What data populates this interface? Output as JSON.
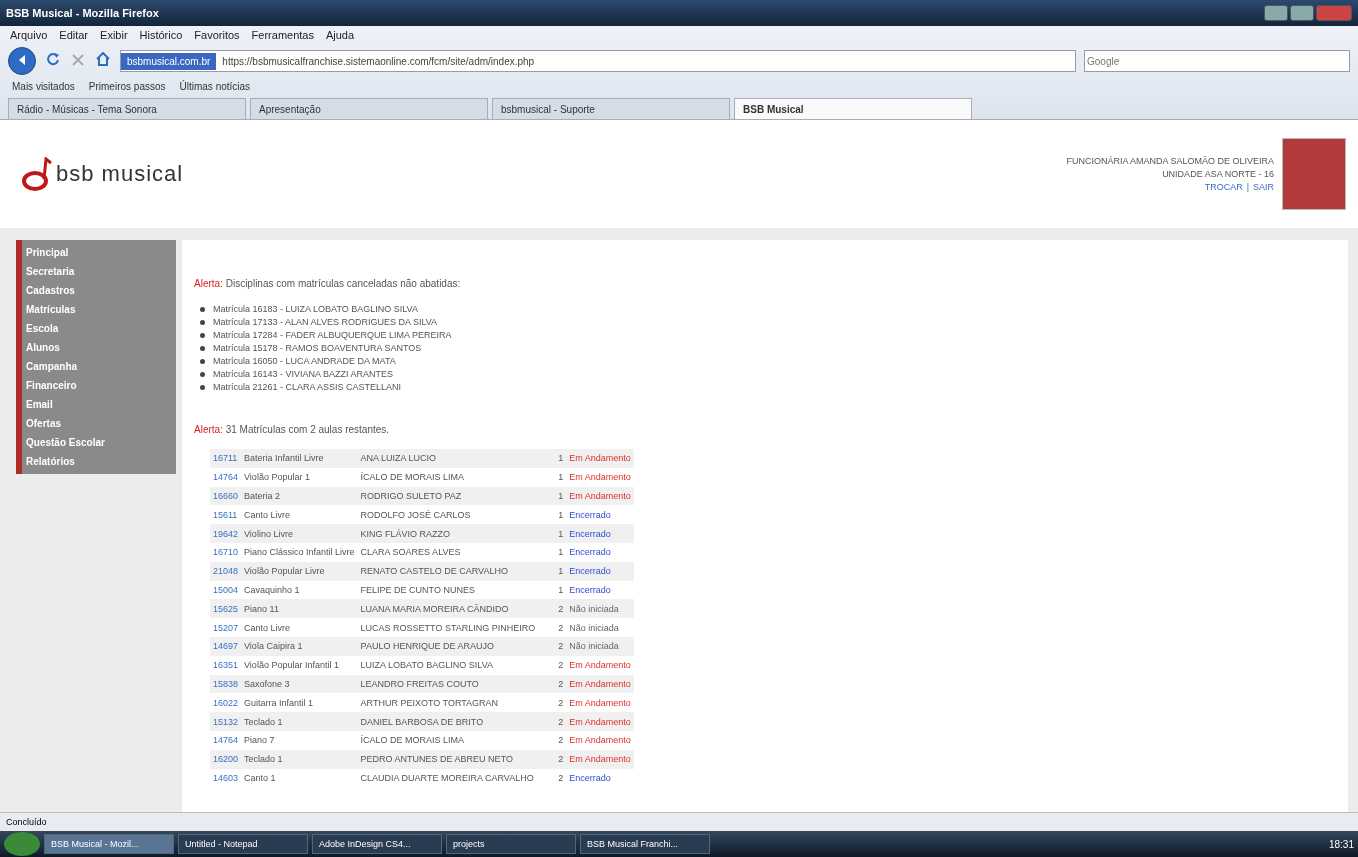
{
  "window": {
    "title": "BSB Musical - Mozilla Firefox"
  },
  "menu": [
    "Arquivo",
    "Editar",
    "Exibir",
    "Histórico",
    "Favoritos",
    "Ferramentas",
    "Ajuda"
  ],
  "address_bar": {
    "site_label": "bsbmusical.com.br",
    "url": "https://bsbmusicalfranchise.sistemaonline.com/fcm/site/adm/index.php"
  },
  "search": {
    "placeholder": "Google"
  },
  "bookmarks": [
    "Mais visitados",
    "Primeiros passos",
    "Últimas notícias"
  ],
  "tabs": [
    {
      "label": "Rádio - Músicas - Tema Sonora",
      "selected": false
    },
    {
      "label": "Apresentação",
      "selected": false
    },
    {
      "label": "bsbmusical - Suporte",
      "selected": false
    },
    {
      "label": "BSB Musical",
      "selected": true
    }
  ],
  "header": {
    "logo": "bsb musical",
    "user_lines": [
      "FUNCIONÁRIA AMANDA SALOMÃO DE OLIVEIRA",
      "UNIDADE ASA NORTE - 16"
    ],
    "links": [
      "TROCAR",
      "SAIR"
    ],
    "link_separator": "|"
  },
  "sidebar": {
    "items": [
      "Principal",
      "Secretaria",
      "Cadastros",
      "Matrículas",
      "Escola",
      "Alunos",
      "Campanha",
      "Financeiro",
      "Email",
      "Ofertas",
      "Questão Escolar",
      "Relatórios"
    ]
  },
  "alerts": [
    {
      "label": "Alerta:",
      "text": "Disciplinas com matrículas canceladas não abatidas:"
    },
    {
      "label": "Alerta:",
      "text": "31 Matrículas com 2 aulas restantes."
    }
  ],
  "canceled": [
    "Matrícula 16183 - LUIZA LOBATO BAGLINO SILVA",
    "Matrícula 17133 - ALAN ALVES RODRIGUES DA SILVA",
    "Matrícula 17284 - FADER ALBUQUERQUE LIMA PEREIRA",
    "Matrícula 15178 - RAMOS BOAVENTURA SANTOS",
    "Matrícula 16050 - LUCA ANDRADE DA MATA",
    "Matrícula 16143 - VIVIANA BAZZI ARANTES",
    "Matrícula 21261 - CLARA ASSIS CASTELLANI"
  ],
  "table": {
    "rows": [
      {
        "id": "16711",
        "course": "Bateria Infantil Livre",
        "student": "ANA LUIZA LUCIO",
        "count": "1",
        "status": "Em Andamento",
        "kind": "progress"
      },
      {
        "id": "14764",
        "course": "Violão Popular 1",
        "student": "ÍCALO DE MORAIS LIMA",
        "count": "1",
        "status": "Em Andamento",
        "kind": "progress"
      },
      {
        "id": "16660",
        "course": "Bateria 2",
        "student": "RODRIGO SULETO PAZ",
        "count": "1",
        "status": "Em Andamento",
        "kind": "progress"
      },
      {
        "id": "15611",
        "course": "Canto Livre",
        "student": "RODOLFO JOSÉ CARLOS",
        "count": "1",
        "status": "Encerrado",
        "kind": "closed"
      },
      {
        "id": "19642",
        "course": "Violino Livre",
        "student": "KING FLÁVIO RAZZO",
        "count": "1",
        "status": "Encerrado",
        "kind": "closed"
      },
      {
        "id": "16710",
        "course": "Piano Clássico Infantil Livre",
        "student": "CLARA SOARES ALVES",
        "count": "1",
        "status": "Encerrado",
        "kind": "closed"
      },
      {
        "id": "21048",
        "course": "Violão Popular Livre",
        "student": "RENATO CASTELO DE CARVALHO",
        "count": "1",
        "status": "Encerrado",
        "kind": "closed"
      },
      {
        "id": "15004",
        "course": "Cavaquinho 1",
        "student": "FELIPE DE CUNTO NUNES",
        "count": "1",
        "status": "Encerrado",
        "kind": "closed"
      },
      {
        "id": "15625",
        "course": "Piano 11",
        "student": "LUANA MARIA MOREIRA CÂNDIDO",
        "count": "2",
        "status": "Não iniciada",
        "kind": "pending"
      },
      {
        "id": "15207",
        "course": "Canto Livre",
        "student": "LUCAS ROSSETTO STARLING PINHEIRO",
        "count": "2",
        "status": "Não iniciada",
        "kind": "pending"
      },
      {
        "id": "14697",
        "course": "Viola Caipira 1",
        "student": "PAULO HENRIQUE DE ARAUJO",
        "count": "2",
        "status": "Não iniciada",
        "kind": "pending"
      },
      {
        "id": "16351",
        "course": "Violão Popular Infantil 1",
        "student": "LUIZA LOBATO BAGLINO SILVA",
        "count": "2",
        "status": "Em Andamento",
        "kind": "progress"
      },
      {
        "id": "15838",
        "course": "Saxofone 3",
        "student": "LEANDRO FREITAS COUTO",
        "count": "2",
        "status": "Em Andamento",
        "kind": "progress"
      },
      {
        "id": "16022",
        "course": "Guitarra Infantil 1",
        "student": "ARTHUR PEIXOTO TORTAGRAN",
        "count": "2",
        "status": "Em Andamento",
        "kind": "progress"
      },
      {
        "id": "15132",
        "course": "Teclado 1",
        "student": "DANIEL BARBOSA DE BRITO",
        "count": "2",
        "status": "Em Andamento",
        "kind": "progress"
      },
      {
        "id": "14764",
        "course": "Piano 7",
        "student": "ÍCALO DE MORAIS LIMA",
        "count": "2",
        "status": "Em Andamento",
        "kind": "progress"
      },
      {
        "id": "16200",
        "course": "Teclado 1",
        "student": "PEDRO ANTUNES DE ABREU NETO",
        "count": "2",
        "status": "Em Andamento",
        "kind": "progress"
      },
      {
        "id": "14603",
        "course": "Canto 1",
        "student": "CLAUDIA DUARTE MOREIRA CARVALHO",
        "count": "2",
        "status": "Encerrado",
        "kind": "closed"
      }
    ]
  },
  "status_bar": "Concluído",
  "taskbar": [
    {
      "label": "BSB Musical - Mozil...",
      "selected": true
    },
    {
      "label": "Untitled - Notepad",
      "selected": false
    },
    {
      "label": "Adobe InDesign CS4...",
      "selected": false
    },
    {
      "label": "projects",
      "selected": false
    },
    {
      "label": "BSB Musical Franchi...",
      "selected": false
    }
  ],
  "clock": "18:31"
}
